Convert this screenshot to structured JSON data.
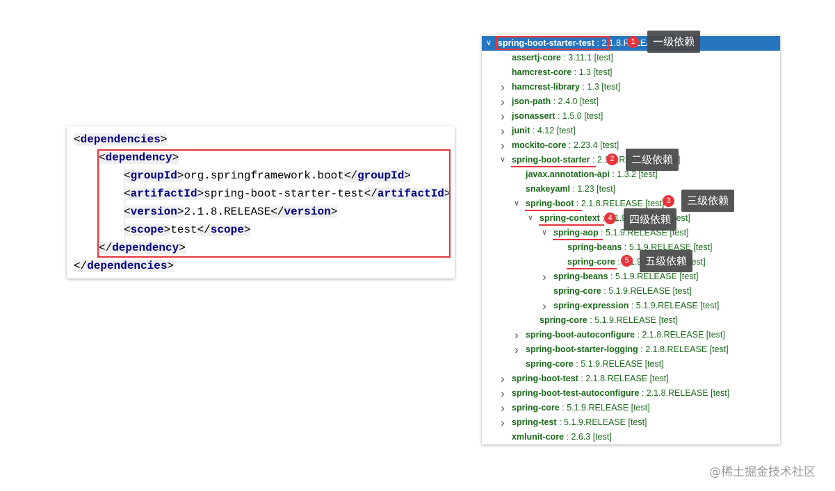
{
  "xml": {
    "open_dependencies": "dependencies",
    "open_dependency": "dependency",
    "group_tag": "groupId",
    "group_value": "org.springframework.boot",
    "artifact_tag": "artifactId",
    "artifact_value": "spring-boot-starter-test",
    "version_tag": "version",
    "version_value": "2.1.8.RELEASE",
    "scope_tag": "scope",
    "scope_value": "test",
    "close_dependency": "dependency",
    "close_dependencies": "dependencies"
  },
  "tree": {
    "rows": [
      {
        "name": "spring-boot-starter-test",
        "version": "2.1.8.RELEASE [test]",
        "indent": 0,
        "chevron": "expanded",
        "selected": true
      },
      {
        "name": "assertj-core",
        "version": "3.11.1 [test]",
        "indent": 1,
        "chevron": "none"
      },
      {
        "name": "hamcrest-core",
        "version": "1.3 [test]",
        "indent": 1,
        "chevron": "none"
      },
      {
        "name": "hamcrest-library",
        "version": "1.3 [test]",
        "indent": 1,
        "chevron": "collapsed"
      },
      {
        "name": "json-path",
        "version": "2.4.0 [test]",
        "indent": 1,
        "chevron": "collapsed"
      },
      {
        "name": "jsonassert",
        "version": "1.5.0 [test]",
        "indent": 1,
        "chevron": "collapsed"
      },
      {
        "name": "junit",
        "version": "4.12 [test]",
        "indent": 1,
        "chevron": "collapsed"
      },
      {
        "name": "mockito-core",
        "version": "2.23.4 [test]",
        "indent": 1,
        "chevron": "collapsed"
      },
      {
        "name": "spring-boot-starter",
        "version": "2.1.8.RELEASE [test]",
        "indent": 1,
        "chevron": "expanded"
      },
      {
        "name": "javax.annotation-api",
        "version": "1.3.2 [test]",
        "indent": 2,
        "chevron": "none"
      },
      {
        "name": "snakeyaml",
        "version": "1.23 [test]",
        "indent": 2,
        "chevron": "none"
      },
      {
        "name": "spring-boot",
        "version": "2.1.8.RELEASE [test]",
        "indent": 2,
        "chevron": "expanded"
      },
      {
        "name": "spring-context",
        "version": "5.1.9.RELEASE [test]",
        "indent": 3,
        "chevron": "expanded"
      },
      {
        "name": "spring-aop",
        "version": "5.1.9.RELEASE [test]",
        "indent": 4,
        "chevron": "expanded"
      },
      {
        "name": "spring-beans",
        "version": "5.1.9.RELEASE [test]",
        "indent": 5,
        "chevron": "none"
      },
      {
        "name": "spring-core",
        "version": "5.1.9.RELEASE [test]",
        "indent": 5,
        "chevron": "none"
      },
      {
        "name": "spring-beans",
        "version": "5.1.9.RELEASE [test]",
        "indent": 4,
        "chevron": "collapsed"
      },
      {
        "name": "spring-core",
        "version": "5.1.9.RELEASE [test]",
        "indent": 4,
        "chevron": "none"
      },
      {
        "name": "spring-expression",
        "version": "5.1.9.RELEASE [test]",
        "indent": 4,
        "chevron": "collapsed"
      },
      {
        "name": "spring-core",
        "version": "5.1.9.RELEASE [test]",
        "indent": 3,
        "chevron": "none"
      },
      {
        "name": "spring-boot-autoconfigure",
        "version": "2.1.8.RELEASE [test]",
        "indent": 2,
        "chevron": "collapsed"
      },
      {
        "name": "spring-boot-starter-logging",
        "version": "2.1.8.RELEASE [test]",
        "indent": 2,
        "chevron": "collapsed"
      },
      {
        "name": "spring-core",
        "version": "5.1.9.RELEASE [test]",
        "indent": 2,
        "chevron": "none"
      },
      {
        "name": "spring-boot-test",
        "version": "2.1.8.RELEASE [test]",
        "indent": 1,
        "chevron": "collapsed"
      },
      {
        "name": "spring-boot-test-autoconfigure",
        "version": "2.1.8.RELEASE [test]",
        "indent": 1,
        "chevron": "collapsed"
      },
      {
        "name": "spring-core",
        "version": "5.1.9.RELEASE [test]",
        "indent": 1,
        "chevron": "collapsed"
      },
      {
        "name": "spring-test",
        "version": "5.1.9.RELEASE [test]",
        "indent": 1,
        "chevron": "collapsed"
      },
      {
        "name": "xmlunit-core",
        "version": "2.6.3 [test]",
        "indent": 1,
        "chevron": "none"
      }
    ]
  },
  "callouts": [
    {
      "num": "1",
      "text": "一级依赖"
    },
    {
      "num": "2",
      "text": "二级依赖"
    },
    {
      "num": "3",
      "text": "三级依赖"
    },
    {
      "num": "4",
      "text": "四级依赖"
    },
    {
      "num": "5",
      "text": "五级依赖"
    }
  ],
  "watermark": "@稀土掘金技术社区",
  "colors": {
    "accent": "#e5363d",
    "selection": "#2675bf",
    "artifact": "#1a6a1a",
    "xml_tag": "#000080"
  }
}
